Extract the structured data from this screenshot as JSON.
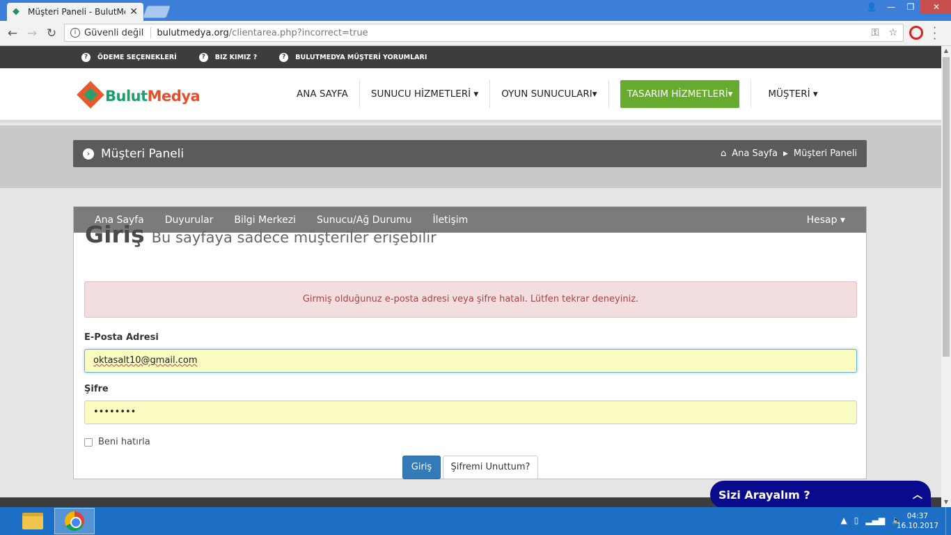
{
  "browser": {
    "tab_title": "Müşteri Paneli - BulutMe",
    "security_label": "Güvenli değil",
    "url_host": "bulutmedya.org",
    "url_path": "/clientarea.php?incorrect=true"
  },
  "topbar": {
    "items": [
      "ÖDEME SEÇENEKLERİ",
      "BIZ KIMIZ ?",
      "BULUTMEDYA MÜŞTERİ YORUMLARI"
    ]
  },
  "logo": {
    "part1": "Bulut",
    "part2": "Medya"
  },
  "mainnav": {
    "items": [
      "ANA SAYFA",
      "SUNUCU HİZMETLERİ ▾",
      "OYUN SUNUCULARI▾",
      "TASARIM HİZMETLERİ▾",
      "MÜŞTERİ ▾"
    ]
  },
  "panel": {
    "title": "Müşteri Paneli",
    "crumb_home": "Ana Sayfa",
    "crumb_current": "Müşteri Paneli"
  },
  "subnav": {
    "items": [
      "Ana Sayfa",
      "Duyurular",
      "Bilgi Merkezi",
      "Sunucu/Ağ Durumu",
      "İletişim"
    ],
    "account": "Hesap ▾"
  },
  "login": {
    "heading": "Giriş",
    "subheading": "Bu sayfaya sadece müşteriler erişebilir",
    "error": "Girmiş olduğunuz e-posta adresi veya şifre hatalı. Lütfen tekrar deneyiniz.",
    "email_label": "E-Posta Adresi",
    "email_value": "oktasalt10@gmail.com",
    "password_label": "Şifre",
    "password_value": "••••••••",
    "remember_label": "Beni hatırla",
    "submit_label": "Giriş",
    "forgot_label": "Şifremi Unuttum?"
  },
  "callback_widget": {
    "label": "Sizi Arayalım ?"
  },
  "taskbar": {
    "time": "04:37",
    "date": "16.10.2017"
  },
  "colors": {
    "accent_green": "#66aa2f",
    "primary_blue": "#337ab7",
    "alert_bg": "#f2dede"
  }
}
